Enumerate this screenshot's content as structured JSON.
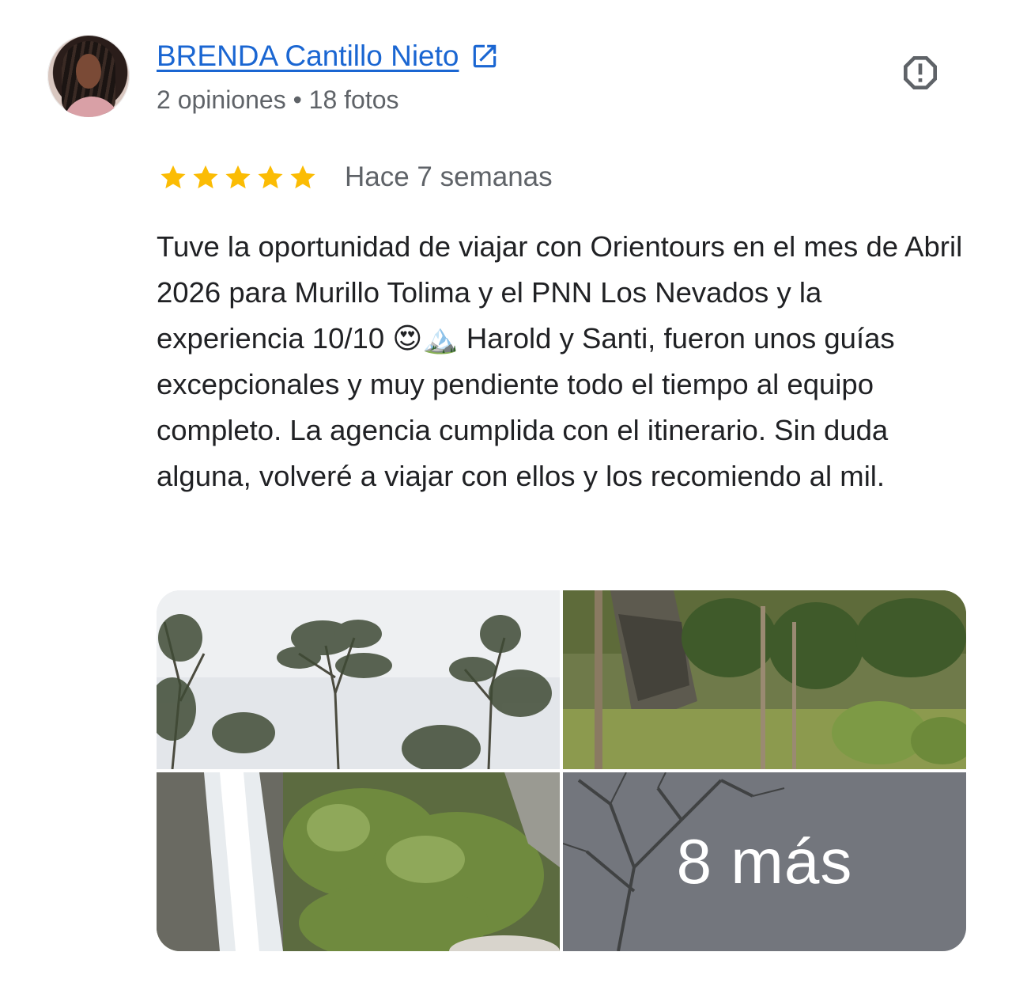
{
  "reviewer": {
    "name": "BRENDA Cantillo Nieto",
    "meta": "2 opiniones • 18 fotos",
    "avatar_icon": "avatar-photo",
    "external_link_icon": "open-in-new-icon"
  },
  "actions": {
    "report_icon": "report-octagon-icon"
  },
  "rating": {
    "stars": 5,
    "max_stars": 5,
    "star_color": "#fbbc04",
    "time": "Hace 7 semanas"
  },
  "review": {
    "text": "Tuve la oportunidad de viajar con Orientours en el mes de Abril 2026 para Murillo Tolima y el PNN Los Nevados y la experiencia 10/10 😍🏔️ Harold y Santi, fueron unos guías excepcionales y muy pendiente todo el tiempo al equipo completo. La agencia cumplida con el itinerario. Sin duda alguna, volveré a viajar con ellos y los recomiendo al mil."
  },
  "photos": {
    "items": [
      {
        "subject": "tall trees against cloudy sky"
      },
      {
        "subject": "forest with rocky cliff"
      },
      {
        "subject": "waterfall with green vegetation"
      },
      {
        "subject": "bare tree branches under grey sky"
      }
    ],
    "more_label": "8 más"
  },
  "colors": {
    "link": "#1a66d2",
    "secondary_text": "#5f6368",
    "primary_text": "#202124"
  }
}
